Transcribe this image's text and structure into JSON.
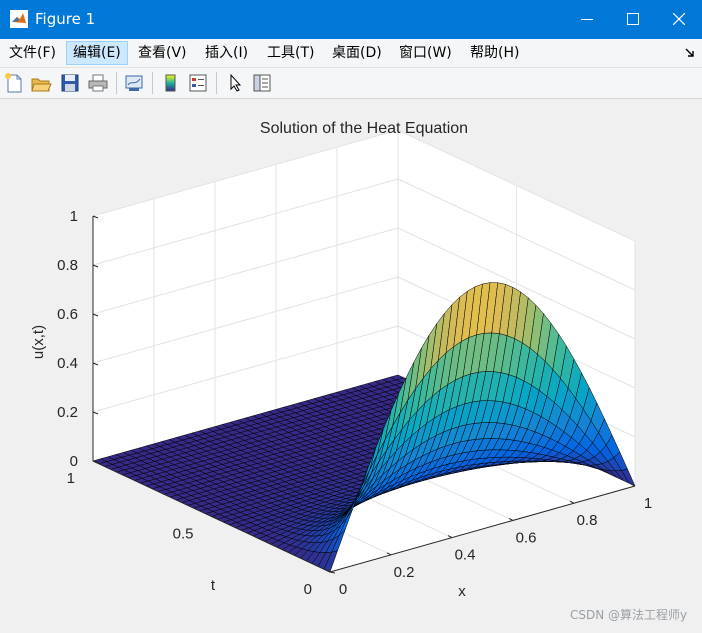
{
  "window": {
    "title": "Figure 1",
    "colors": {
      "titlebar": "#0078d7"
    }
  },
  "menu": {
    "items": [
      {
        "label": "文件(F)"
      },
      {
        "label": "编辑(E)"
      },
      {
        "label": "查看(V)"
      },
      {
        "label": "插入(I)"
      },
      {
        "label": "工具(T)"
      },
      {
        "label": "桌面(D)"
      },
      {
        "label": "窗口(W)"
      },
      {
        "label": "帮助(H)"
      }
    ]
  },
  "toolbar": {
    "icons": [
      "new-figure-icon",
      "open-file-icon",
      "save-icon",
      "print-icon",
      "link-plot-icon",
      "colorbar-icon",
      "legend-icon",
      "pointer-icon",
      "property-inspector-icon"
    ]
  },
  "chart_data": {
    "type": "surface",
    "title": "Solution of the Heat Equation",
    "xlabel": "x",
    "ylabel": "t",
    "zlabel": "u(x,t)",
    "xlim": [
      0,
      1
    ],
    "ylim": [
      0,
      1
    ],
    "zlim": [
      0,
      1
    ],
    "xticks": [
      "0",
      "0.2",
      "0.4",
      "0.6",
      "0.8",
      "1"
    ],
    "yticks": [
      "0",
      "0.5",
      "1"
    ],
    "zticks": [
      "0",
      "0.2",
      "0.4",
      "0.6",
      "0.8",
      "1"
    ],
    "function": "u(x,t) = sin(pi*x) * exp(-pi^2*t)",
    "colormap": "parula",
    "grid": true
  },
  "watermark": "CSDN @算法工程师y"
}
